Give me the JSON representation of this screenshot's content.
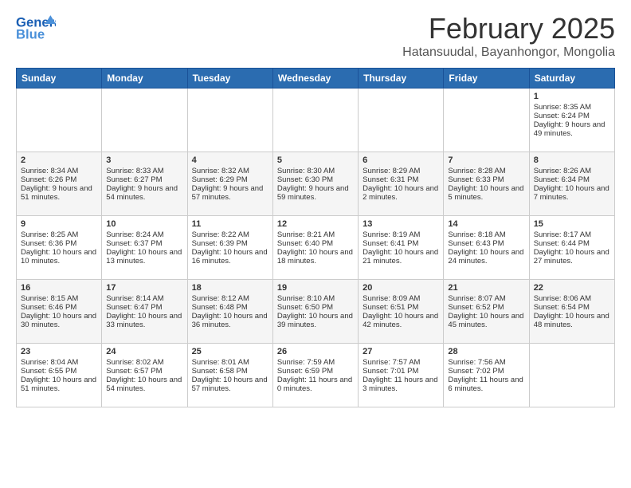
{
  "header": {
    "logo_general": "General",
    "logo_blue": "Blue",
    "month_title": "February 2025",
    "subtitle": "Hatansuudal, Bayanhongor, Mongolia"
  },
  "days_of_week": [
    "Sunday",
    "Monday",
    "Tuesday",
    "Wednesday",
    "Thursday",
    "Friday",
    "Saturday"
  ],
  "weeks": [
    {
      "row_class": "normal-row",
      "days": [
        {
          "num": "",
          "info": ""
        },
        {
          "num": "",
          "info": ""
        },
        {
          "num": "",
          "info": ""
        },
        {
          "num": "",
          "info": ""
        },
        {
          "num": "",
          "info": ""
        },
        {
          "num": "",
          "info": ""
        },
        {
          "num": "1",
          "info": "Sunrise: 8:35 AM\nSunset: 6:24 PM\nDaylight: 9 hours and 49 minutes."
        }
      ]
    },
    {
      "row_class": "alt-row",
      "days": [
        {
          "num": "2",
          "info": "Sunrise: 8:34 AM\nSunset: 6:26 PM\nDaylight: 9 hours and 51 minutes."
        },
        {
          "num": "3",
          "info": "Sunrise: 8:33 AM\nSunset: 6:27 PM\nDaylight: 9 hours and 54 minutes."
        },
        {
          "num": "4",
          "info": "Sunrise: 8:32 AM\nSunset: 6:29 PM\nDaylight: 9 hours and 57 minutes."
        },
        {
          "num": "5",
          "info": "Sunrise: 8:30 AM\nSunset: 6:30 PM\nDaylight: 9 hours and 59 minutes."
        },
        {
          "num": "6",
          "info": "Sunrise: 8:29 AM\nSunset: 6:31 PM\nDaylight: 10 hours and 2 minutes."
        },
        {
          "num": "7",
          "info": "Sunrise: 8:28 AM\nSunset: 6:33 PM\nDaylight: 10 hours and 5 minutes."
        },
        {
          "num": "8",
          "info": "Sunrise: 8:26 AM\nSunset: 6:34 PM\nDaylight: 10 hours and 7 minutes."
        }
      ]
    },
    {
      "row_class": "normal-row",
      "days": [
        {
          "num": "9",
          "info": "Sunrise: 8:25 AM\nSunset: 6:36 PM\nDaylight: 10 hours and 10 minutes."
        },
        {
          "num": "10",
          "info": "Sunrise: 8:24 AM\nSunset: 6:37 PM\nDaylight: 10 hours and 13 minutes."
        },
        {
          "num": "11",
          "info": "Sunrise: 8:22 AM\nSunset: 6:39 PM\nDaylight: 10 hours and 16 minutes."
        },
        {
          "num": "12",
          "info": "Sunrise: 8:21 AM\nSunset: 6:40 PM\nDaylight: 10 hours and 18 minutes."
        },
        {
          "num": "13",
          "info": "Sunrise: 8:19 AM\nSunset: 6:41 PM\nDaylight: 10 hours and 21 minutes."
        },
        {
          "num": "14",
          "info": "Sunrise: 8:18 AM\nSunset: 6:43 PM\nDaylight: 10 hours and 24 minutes."
        },
        {
          "num": "15",
          "info": "Sunrise: 8:17 AM\nSunset: 6:44 PM\nDaylight: 10 hours and 27 minutes."
        }
      ]
    },
    {
      "row_class": "alt-row",
      "days": [
        {
          "num": "16",
          "info": "Sunrise: 8:15 AM\nSunset: 6:46 PM\nDaylight: 10 hours and 30 minutes."
        },
        {
          "num": "17",
          "info": "Sunrise: 8:14 AM\nSunset: 6:47 PM\nDaylight: 10 hours and 33 minutes."
        },
        {
          "num": "18",
          "info": "Sunrise: 8:12 AM\nSunset: 6:48 PM\nDaylight: 10 hours and 36 minutes."
        },
        {
          "num": "19",
          "info": "Sunrise: 8:10 AM\nSunset: 6:50 PM\nDaylight: 10 hours and 39 minutes."
        },
        {
          "num": "20",
          "info": "Sunrise: 8:09 AM\nSunset: 6:51 PM\nDaylight: 10 hours and 42 minutes."
        },
        {
          "num": "21",
          "info": "Sunrise: 8:07 AM\nSunset: 6:52 PM\nDaylight: 10 hours and 45 minutes."
        },
        {
          "num": "22",
          "info": "Sunrise: 8:06 AM\nSunset: 6:54 PM\nDaylight: 10 hours and 48 minutes."
        }
      ]
    },
    {
      "row_class": "normal-row",
      "days": [
        {
          "num": "23",
          "info": "Sunrise: 8:04 AM\nSunset: 6:55 PM\nDaylight: 10 hours and 51 minutes."
        },
        {
          "num": "24",
          "info": "Sunrise: 8:02 AM\nSunset: 6:57 PM\nDaylight: 10 hours and 54 minutes."
        },
        {
          "num": "25",
          "info": "Sunrise: 8:01 AM\nSunset: 6:58 PM\nDaylight: 10 hours and 57 minutes."
        },
        {
          "num": "26",
          "info": "Sunrise: 7:59 AM\nSunset: 6:59 PM\nDaylight: 11 hours and 0 minutes."
        },
        {
          "num": "27",
          "info": "Sunrise: 7:57 AM\nSunset: 7:01 PM\nDaylight: 11 hours and 3 minutes."
        },
        {
          "num": "28",
          "info": "Sunrise: 7:56 AM\nSunset: 7:02 PM\nDaylight: 11 hours and 6 minutes."
        },
        {
          "num": "",
          "info": ""
        }
      ]
    }
  ]
}
